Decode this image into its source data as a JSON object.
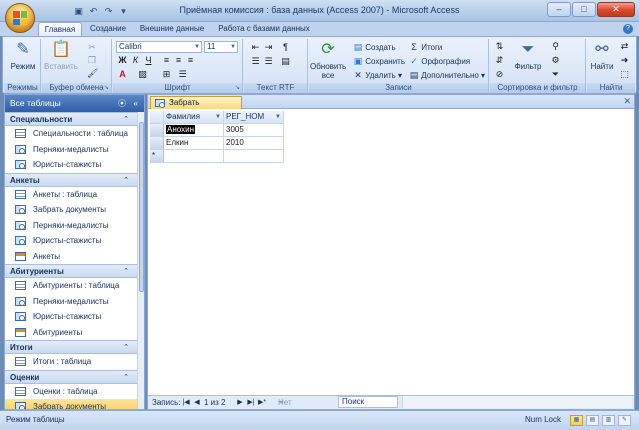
{
  "window": {
    "title": "Приёмная комиссия : база данных (Access 2007) - Microsoft Access"
  },
  "ribbon_tabs": [
    "Главная",
    "Создание",
    "Внешние данные",
    "Работа с базами данных"
  ],
  "ribbon": {
    "view": {
      "label": "Режим",
      "group": "Режимы"
    },
    "clipboard": {
      "paste": "Вставить",
      "group": "Буфер обмена"
    },
    "font": {
      "name": "Calibri",
      "size": "11",
      "bold": "Ж",
      "italic": "К",
      "underline": "Ч",
      "color_a": "A",
      "group": "Шрифт"
    },
    "rtf": {
      "group": "Текст RTF"
    },
    "records": {
      "refresh": "Обновить все",
      "new": "Создать",
      "save": "Сохранить",
      "delete": "Удалить",
      "totals": "Итоги",
      "spelling": "Орфография",
      "more": "Дополнительно",
      "group": "Записи"
    },
    "sort_filter": {
      "filter": "Фильтр",
      "group": "Сортировка и фильтр"
    },
    "find": {
      "find": "Найти",
      "group": "Найти"
    }
  },
  "nav": {
    "header": "Все таблицы",
    "groups": [
      {
        "title": "Специальности",
        "items": [
          {
            "label": "Специальности : таблица",
            "icon": "table-icon"
          },
          {
            "label": "Перняки-медалисты",
            "icon": "query-icon"
          },
          {
            "label": "Юристы-стажисты",
            "icon": "query-icon"
          }
        ]
      },
      {
        "title": "Анкеты",
        "items": [
          {
            "label": "Анкеты : таблица",
            "icon": "table-icon"
          },
          {
            "label": "Забрать документы",
            "icon": "query-icon"
          },
          {
            "label": "Перняки-медалисты",
            "icon": "query-icon"
          },
          {
            "label": "Юристы-стажисты",
            "icon": "query-icon"
          },
          {
            "label": "Анкеты",
            "icon": "form-icon"
          }
        ]
      },
      {
        "title": "Абитуриенты",
        "items": [
          {
            "label": "Абитуриенты : таблица",
            "icon": "table-icon"
          },
          {
            "label": "Перняки-медалисты",
            "icon": "query-icon"
          },
          {
            "label": "Юристы-стажисты",
            "icon": "query-icon"
          },
          {
            "label": "Абитуриенты",
            "icon": "form-icon"
          }
        ]
      },
      {
        "title": "Итоги",
        "items": [
          {
            "label": "Итоги : таблица",
            "icon": "table-icon"
          }
        ]
      },
      {
        "title": "Оценки",
        "items": [
          {
            "label": "Оценки : таблица",
            "icon": "table-icon"
          },
          {
            "label": "Забрать документы",
            "icon": "query-icon",
            "selected": true
          }
        ]
      }
    ]
  },
  "document": {
    "tab": "Забрать документы",
    "columns": [
      "Фамилия",
      "РЕГ_НОМ"
    ],
    "rows": [
      [
        "Анохин",
        "3005"
      ],
      [
        "Елкин",
        "2010"
      ]
    ],
    "new_row_marker": "*",
    "record_nav": {
      "label": "Запись:",
      "position": "1 из 2",
      "filter": "Нет фильтра",
      "search": "Поиск"
    }
  },
  "status": {
    "left": "Режим таблицы",
    "right": "Num Lock"
  },
  "colors": {
    "accent": "#2d5ea8",
    "selection": "#f8c85e"
  }
}
